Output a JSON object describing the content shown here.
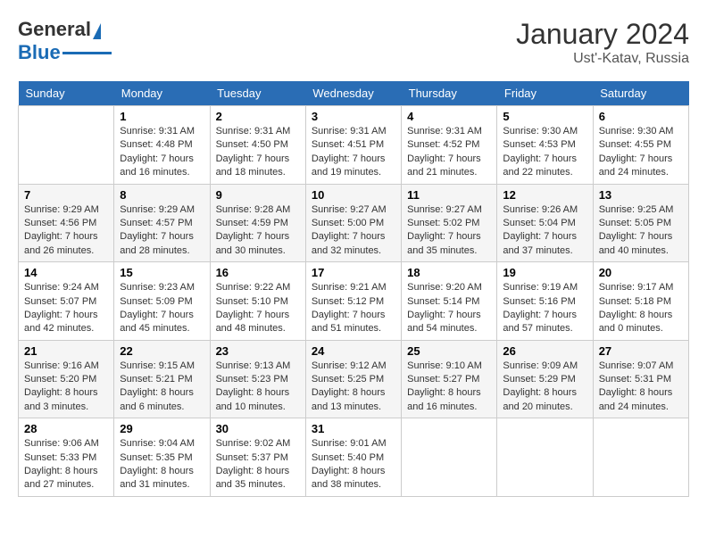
{
  "header": {
    "logo_general": "General",
    "logo_blue": "Blue",
    "month_year": "January 2024",
    "location": "Ust'-Katav, Russia"
  },
  "weekdays": [
    "Sunday",
    "Monday",
    "Tuesday",
    "Wednesday",
    "Thursday",
    "Friday",
    "Saturday"
  ],
  "weeks": [
    [
      {
        "day": null,
        "sunrise": null,
        "sunset": null,
        "daylight": null
      },
      {
        "day": "1",
        "sunrise": "9:31 AM",
        "sunset": "4:48 PM",
        "daylight": "7 hours and 16 minutes."
      },
      {
        "day": "2",
        "sunrise": "9:31 AM",
        "sunset": "4:50 PM",
        "daylight": "7 hours and 18 minutes."
      },
      {
        "day": "3",
        "sunrise": "9:31 AM",
        "sunset": "4:51 PM",
        "daylight": "7 hours and 19 minutes."
      },
      {
        "day": "4",
        "sunrise": "9:31 AM",
        "sunset": "4:52 PM",
        "daylight": "7 hours and 21 minutes."
      },
      {
        "day": "5",
        "sunrise": "9:30 AM",
        "sunset": "4:53 PM",
        "daylight": "7 hours and 22 minutes."
      },
      {
        "day": "6",
        "sunrise": "9:30 AM",
        "sunset": "4:55 PM",
        "daylight": "7 hours and 24 minutes."
      }
    ],
    [
      {
        "day": "7",
        "sunrise": "9:29 AM",
        "sunset": "4:56 PM",
        "daylight": "7 hours and 26 minutes."
      },
      {
        "day": "8",
        "sunrise": "9:29 AM",
        "sunset": "4:57 PM",
        "daylight": "7 hours and 28 minutes."
      },
      {
        "day": "9",
        "sunrise": "9:28 AM",
        "sunset": "4:59 PM",
        "daylight": "7 hours and 30 minutes."
      },
      {
        "day": "10",
        "sunrise": "9:27 AM",
        "sunset": "5:00 PM",
        "daylight": "7 hours and 32 minutes."
      },
      {
        "day": "11",
        "sunrise": "9:27 AM",
        "sunset": "5:02 PM",
        "daylight": "7 hours and 35 minutes."
      },
      {
        "day": "12",
        "sunrise": "9:26 AM",
        "sunset": "5:04 PM",
        "daylight": "7 hours and 37 minutes."
      },
      {
        "day": "13",
        "sunrise": "9:25 AM",
        "sunset": "5:05 PM",
        "daylight": "7 hours and 40 minutes."
      }
    ],
    [
      {
        "day": "14",
        "sunrise": "9:24 AM",
        "sunset": "5:07 PM",
        "daylight": "7 hours and 42 minutes."
      },
      {
        "day": "15",
        "sunrise": "9:23 AM",
        "sunset": "5:09 PM",
        "daylight": "7 hours and 45 minutes."
      },
      {
        "day": "16",
        "sunrise": "9:22 AM",
        "sunset": "5:10 PM",
        "daylight": "7 hours and 48 minutes."
      },
      {
        "day": "17",
        "sunrise": "9:21 AM",
        "sunset": "5:12 PM",
        "daylight": "7 hours and 51 minutes."
      },
      {
        "day": "18",
        "sunrise": "9:20 AM",
        "sunset": "5:14 PM",
        "daylight": "7 hours and 54 minutes."
      },
      {
        "day": "19",
        "sunrise": "9:19 AM",
        "sunset": "5:16 PM",
        "daylight": "7 hours and 57 minutes."
      },
      {
        "day": "20",
        "sunrise": "9:17 AM",
        "sunset": "5:18 PM",
        "daylight": "8 hours and 0 minutes."
      }
    ],
    [
      {
        "day": "21",
        "sunrise": "9:16 AM",
        "sunset": "5:20 PM",
        "daylight": "8 hours and 3 minutes."
      },
      {
        "day": "22",
        "sunrise": "9:15 AM",
        "sunset": "5:21 PM",
        "daylight": "8 hours and 6 minutes."
      },
      {
        "day": "23",
        "sunrise": "9:13 AM",
        "sunset": "5:23 PM",
        "daylight": "8 hours and 10 minutes."
      },
      {
        "day": "24",
        "sunrise": "9:12 AM",
        "sunset": "5:25 PM",
        "daylight": "8 hours and 13 minutes."
      },
      {
        "day": "25",
        "sunrise": "9:10 AM",
        "sunset": "5:27 PM",
        "daylight": "8 hours and 16 minutes."
      },
      {
        "day": "26",
        "sunrise": "9:09 AM",
        "sunset": "5:29 PM",
        "daylight": "8 hours and 20 minutes."
      },
      {
        "day": "27",
        "sunrise": "9:07 AM",
        "sunset": "5:31 PM",
        "daylight": "8 hours and 24 minutes."
      }
    ],
    [
      {
        "day": "28",
        "sunrise": "9:06 AM",
        "sunset": "5:33 PM",
        "daylight": "8 hours and 27 minutes."
      },
      {
        "day": "29",
        "sunrise": "9:04 AM",
        "sunset": "5:35 PM",
        "daylight": "8 hours and 31 minutes."
      },
      {
        "day": "30",
        "sunrise": "9:02 AM",
        "sunset": "5:37 PM",
        "daylight": "8 hours and 35 minutes."
      },
      {
        "day": "31",
        "sunrise": "9:01 AM",
        "sunset": "5:40 PM",
        "daylight": "8 hours and 38 minutes."
      },
      {
        "day": null,
        "sunrise": null,
        "sunset": null,
        "daylight": null
      },
      {
        "day": null,
        "sunrise": null,
        "sunset": null,
        "daylight": null
      },
      {
        "day": null,
        "sunrise": null,
        "sunset": null,
        "daylight": null
      }
    ]
  ]
}
